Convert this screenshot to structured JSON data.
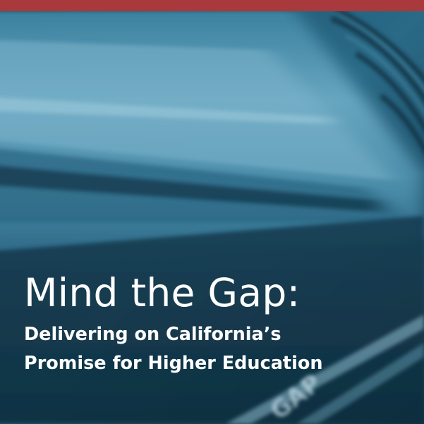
{
  "colors": {
    "top_bar": "#a8393c",
    "overlay_base": "#1f5570",
    "text": "#ffffff"
  },
  "floor_marking": {
    "text": "GAP"
  },
  "cover": {
    "title": "Mind the Gap:",
    "subtitle_line1": "Delivering on California’s",
    "subtitle_line2": "Promise for Higher Education"
  }
}
